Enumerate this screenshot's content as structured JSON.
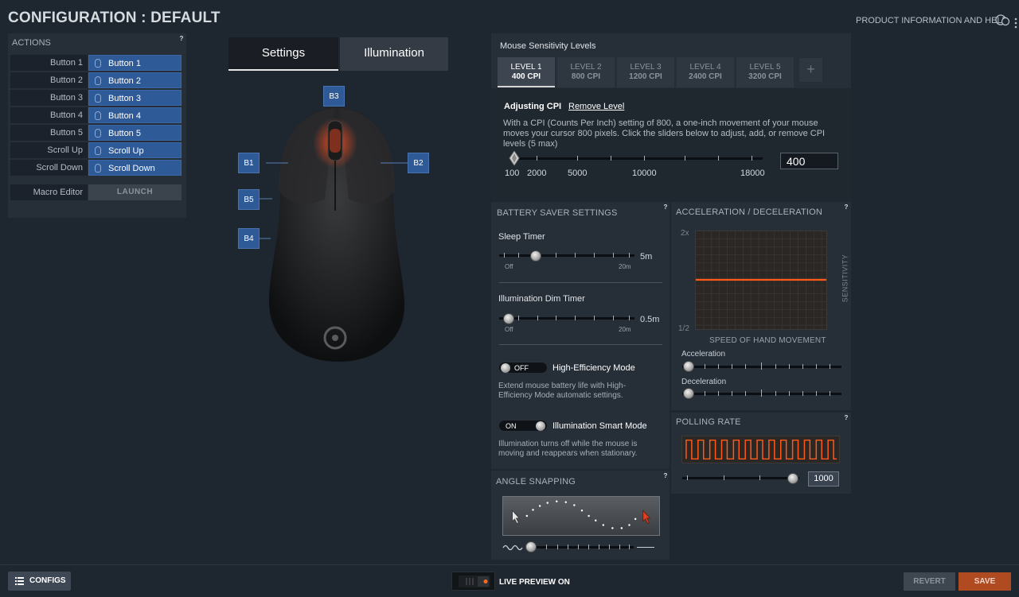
{
  "header": {
    "title": "CONFIGURATION : DEFAULT",
    "product_info": "PRODUCT INFORMATION AND HELP"
  },
  "actions": {
    "title": "ACTIONS",
    "help": "?",
    "rows": [
      {
        "label": "Button 1",
        "value": "Button 1"
      },
      {
        "label": "Button 2",
        "value": "Button 2"
      },
      {
        "label": "Button 3",
        "value": "Button 3"
      },
      {
        "label": "Button 4",
        "value": "Button 4"
      },
      {
        "label": "Button 5",
        "value": "Button 5"
      },
      {
        "label": "Scroll Up",
        "value": "Scroll Up"
      },
      {
        "label": "Scroll Down",
        "value": "Scroll Down"
      }
    ],
    "macro_label": "Macro Editor",
    "launch_label": "LAUNCH"
  },
  "tabs": {
    "settings": "Settings",
    "illumination": "Illumination"
  },
  "mouse_badges": {
    "b1": "B1",
    "b2": "B2",
    "b3": "B3",
    "b4": "B4",
    "b5": "B5"
  },
  "sensitivity": {
    "title": "Mouse Sensitivity Levels",
    "levels": [
      {
        "name": "LEVEL 1",
        "cpi": "400 CPI"
      },
      {
        "name": "LEVEL 2",
        "cpi": "800 CPI"
      },
      {
        "name": "LEVEL 3",
        "cpi": "1200 CPI"
      },
      {
        "name": "LEVEL 4",
        "cpi": "2400 CPI"
      },
      {
        "name": "LEVEL 5",
        "cpi": "3200 CPI"
      }
    ],
    "add_label": "+",
    "adjusting": "Adjusting CPI",
    "remove": "Remove Level",
    "description": "With a CPI (Counts Per Inch) setting of 800, a one-inch movement of your mouse moves your cursor 800 pixels. Click the sliders below to adjust, add, or remove CPI levels (5 max)",
    "ticks": [
      "100",
      "2000",
      "5000",
      "10000",
      "18000"
    ],
    "value": "400"
  },
  "battery": {
    "title": "BATTERY SAVER SETTINGS",
    "help": "?",
    "sleep_label": "Sleep Timer",
    "sleep_value": "5m",
    "sleep_min": "Off",
    "sleep_max": "20m",
    "dim_label": "Illumination Dim Timer",
    "dim_value": "0.5m",
    "dim_min": "Off",
    "dim_max": "20m",
    "he_toggle": "OFF",
    "he_label": "High-Efficiency Mode",
    "he_desc": "Extend mouse battery life with High-Efficiency Mode automatic settings.",
    "smart_toggle": "ON",
    "smart_label": "Illumination Smart Mode",
    "smart_desc": "Illumination turns off while the mouse is moving and reappears when stationary."
  },
  "angle": {
    "title": "ANGLE SNAPPING",
    "help": "?"
  },
  "accel": {
    "title": "ACCELERATION / DECELERATION",
    "help": "?",
    "y_top": "2x",
    "y_bottom": "1/2",
    "x_label": "SPEED OF HAND MOVEMENT",
    "y_label": "SENSITIVITY",
    "accel_label": "Acceleration",
    "decel_label": "Deceleration"
  },
  "polling": {
    "title": "POLLING RATE",
    "help": "?",
    "value": "1000"
  },
  "footer": {
    "configs": "CONFIGS",
    "live_preview": "LIVE PREVIEW ON",
    "revert": "REVERT",
    "save": "SAVE"
  },
  "colors": {
    "accent_blue": "#2f5a98",
    "accent_orange": "#e8501a",
    "save_orange": "#b04a20"
  }
}
